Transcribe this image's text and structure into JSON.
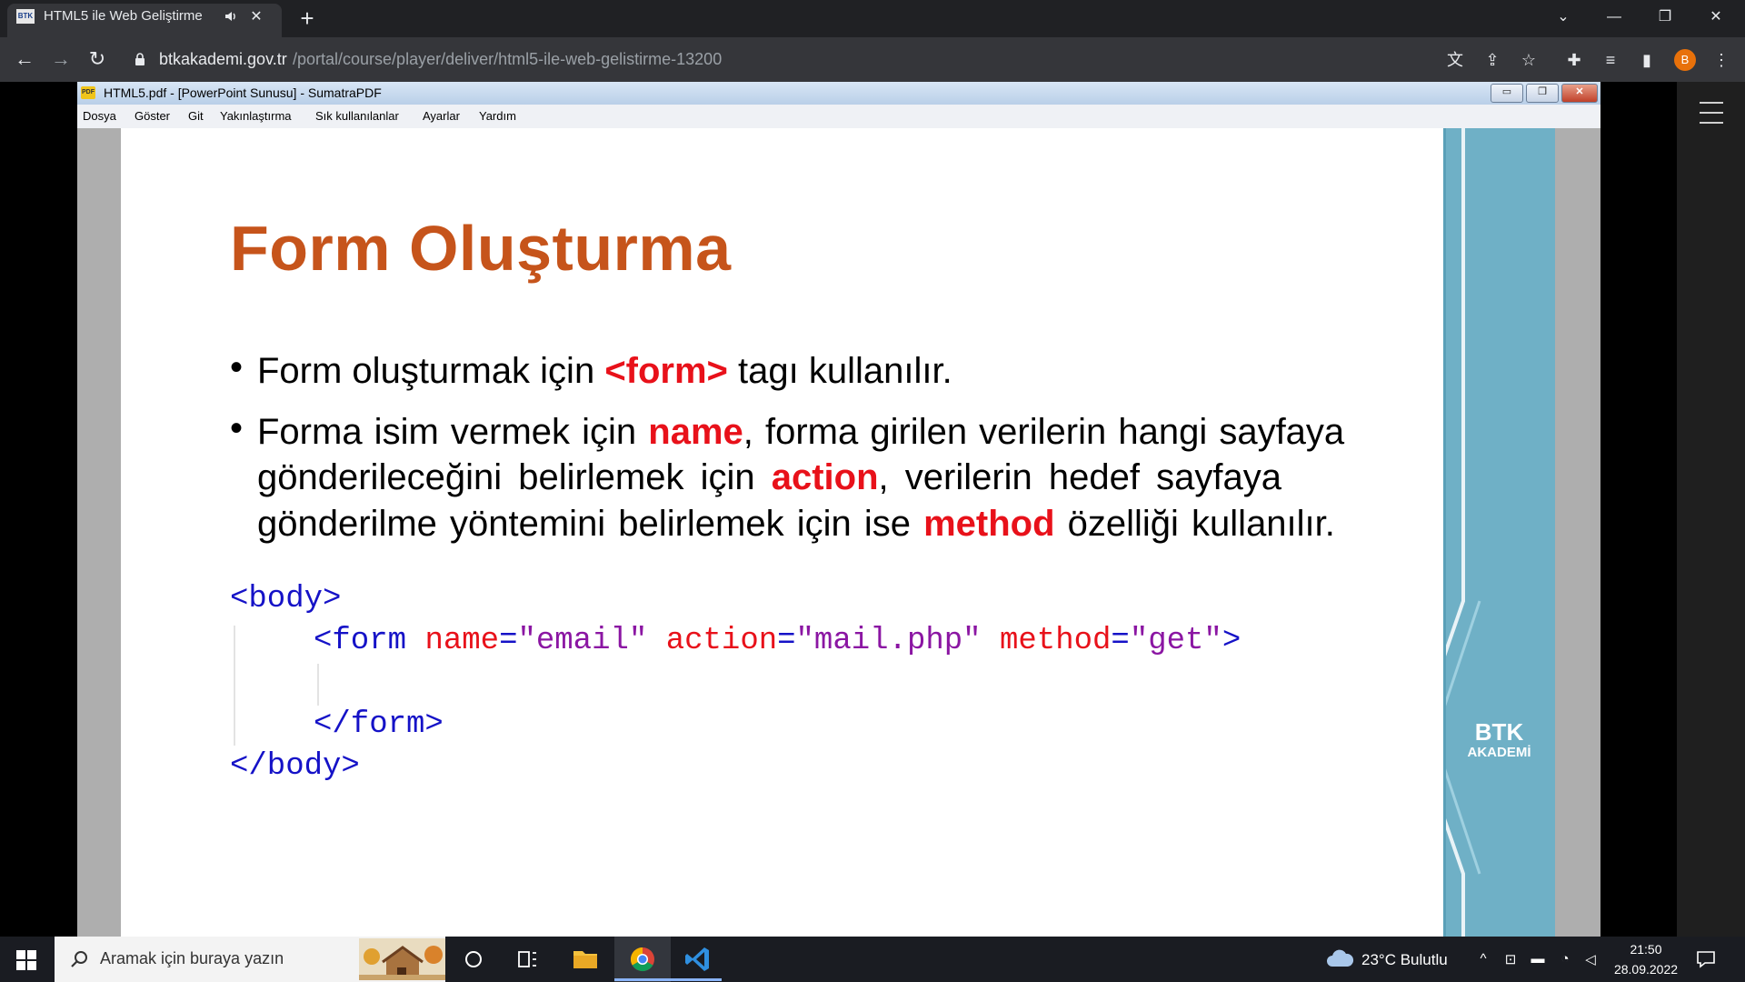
{
  "browser": {
    "tab": {
      "favicon_text": "BTK",
      "title": "HTML5 ile Web Geliştirme"
    },
    "url": {
      "domain": "btkakademi.gov.tr",
      "path": "/portal/course/player/deliver/html5-ile-web-gelistirme-13200"
    },
    "profile_initial": "B"
  },
  "sumatra": {
    "icon_text": "PDF",
    "title": "HTML5.pdf - [PowerPoint Sunusu] - SumatraPDF",
    "menu": [
      "Dosya",
      "Göster",
      "Git",
      "Yakınlaştırma",
      "Sık kullanılanlar",
      "Ayarlar",
      "Yardım"
    ]
  },
  "slide": {
    "title": "Form Oluşturma",
    "bullet1": {
      "pre": "Form oluşturmak için ",
      "kw": "<form>",
      "post": " tagı kullanılır."
    },
    "bullet2": {
      "l1_pre": "Forma isim vermek için ",
      "l1_kw": "name",
      "l1_post": ", forma girilen verilerin hangi sayfaya",
      "l2_pre": "gönderileceğini belirlemek için ",
      "l2_kw": "action",
      "l2_post": ", verilerin hedef sayfaya",
      "l3_pre": "gönderilme yöntemini belirlemek için ise ",
      "l3_kw": "method",
      "l3_post": " özelliği kullanılır."
    },
    "code": {
      "body_open": "<body>",
      "form_open_tag": "<form",
      "attr_name": "name",
      "val_name": "\"email\"",
      "attr_action": "action",
      "val_action": "\"mail.php\"",
      "attr_method": "method",
      "val_method": "\"get\"",
      "close_bracket": ">",
      "equals": "=",
      "form_close": "</form>",
      "body_close": "</body>"
    },
    "brand": {
      "name": "BTK",
      "sub": "AKADEMİ"
    }
  },
  "taskbar": {
    "search_placeholder": "Aramak için buraya yazın",
    "weather": "23°C  Bulutlu",
    "time": "21:50",
    "date": "28.09.2022"
  },
  "colors": {
    "title_orange": "#c6541b",
    "keyword_red": "#e8111a",
    "tag_blue": "#1512c7",
    "value_purple": "#8b16a3",
    "deco_teal": "#6fb0c6"
  }
}
